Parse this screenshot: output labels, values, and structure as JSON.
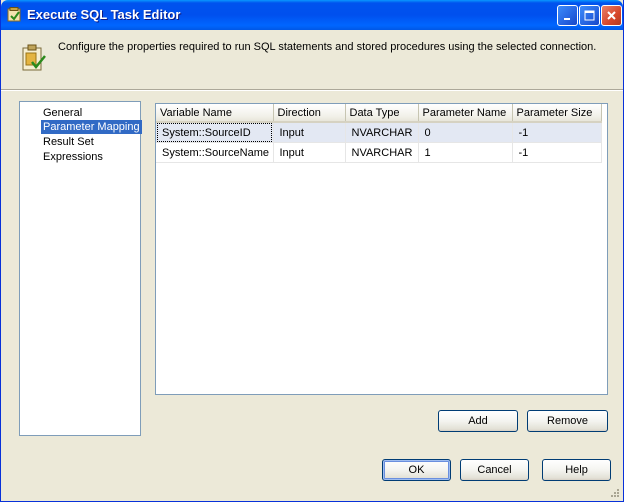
{
  "window": {
    "title": "Execute SQL Task Editor",
    "description": "Configure the properties required to run SQL statements and stored procedures using the selected connection."
  },
  "nav": {
    "items": [
      {
        "label": "General",
        "selected": false
      },
      {
        "label": "Parameter Mapping",
        "selected": true
      },
      {
        "label": "Result Set",
        "selected": false
      },
      {
        "label": "Expressions",
        "selected": false
      }
    ]
  },
  "grid": {
    "columns": [
      "Variable Name",
      "Direction",
      "Data Type",
      "Parameter Name",
      "Parameter Size"
    ],
    "rows": [
      [
        "System::SourceID",
        "Input",
        "NVARCHAR",
        "0",
        "-1"
      ],
      [
        "System::SourceName",
        "Input",
        "NVARCHAR",
        "1",
        "-1"
      ]
    ],
    "selected_row": 0
  },
  "buttons": {
    "add": "Add",
    "remove": "Remove",
    "ok": "OK",
    "cancel": "Cancel",
    "help": "Help"
  },
  "colors": {
    "titlebar": "#0054E3",
    "selection": "#316AC5",
    "close_button": "#D7472B"
  },
  "icons": {
    "title": "sql-task-icon",
    "header": "task-properties-icon",
    "minimize": "minimize-icon",
    "maximize": "maximize-icon",
    "close": "close-icon"
  }
}
